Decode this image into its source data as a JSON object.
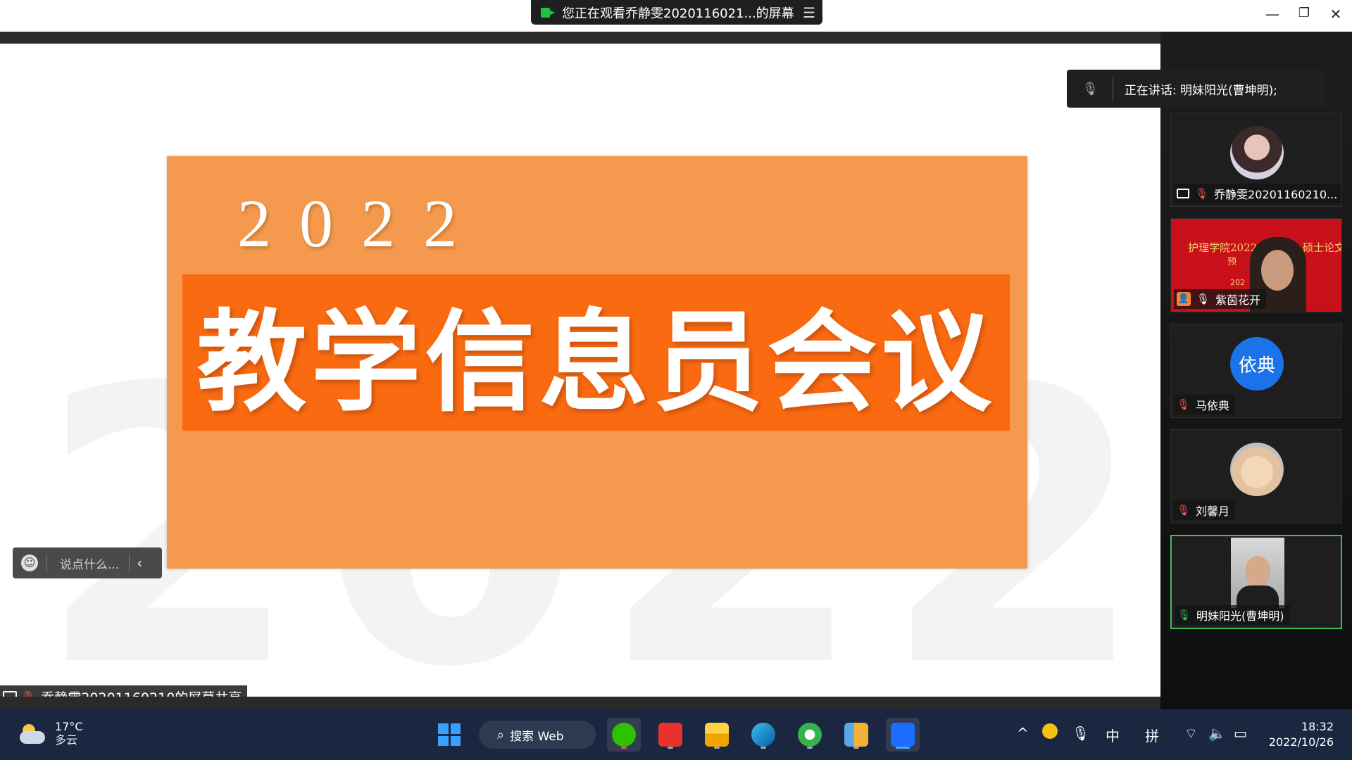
{
  "top": {
    "share_banner": "您正在观看乔静雯2020116021...的屏幕",
    "share_banner_menu_icon": "menu-icon",
    "window_controls": {
      "minimize": "—",
      "restore": "❐",
      "close": "✕"
    }
  },
  "slide": {
    "year": "2022",
    "title": "教学信息员会议",
    "background_digits": [
      "2",
      "0",
      "2",
      "2"
    ],
    "colors": {
      "slide_bg": "#f5994e",
      "band_bg": "#f96a11"
    }
  },
  "chat": {
    "placeholder": "说点什么..."
  },
  "share_label": "乔静雯20201160210的屏幕共享",
  "speaking": {
    "text": "正在讲话: 明妹阳光(曹坤明);"
  },
  "participants": [
    {
      "name": "乔静雯20201160210...",
      "mic": "muted",
      "sharing": true
    },
    {
      "name": "紫茵花开",
      "mic": "on",
      "host": true,
      "video_text_1": "护理学院2022",
      "video_text_2": "硕士论文",
      "video_text_3": "预",
      "video_text_4": "202"
    },
    {
      "name": "马依典",
      "mic": "muted",
      "initials": "依典"
    },
    {
      "name": "刘馨月",
      "mic": "muted"
    },
    {
      "name": "明妹阳光(曹坤明)",
      "mic": "speaking"
    }
  ],
  "taskbar": {
    "weather": {
      "temp": "17°C",
      "condition": "多云"
    },
    "search_label": "搜索 Web",
    "tray": {
      "ime_lang": "中",
      "ime_mode": "拼"
    },
    "clock": {
      "time": "18:32",
      "date": "2022/10/26"
    }
  }
}
